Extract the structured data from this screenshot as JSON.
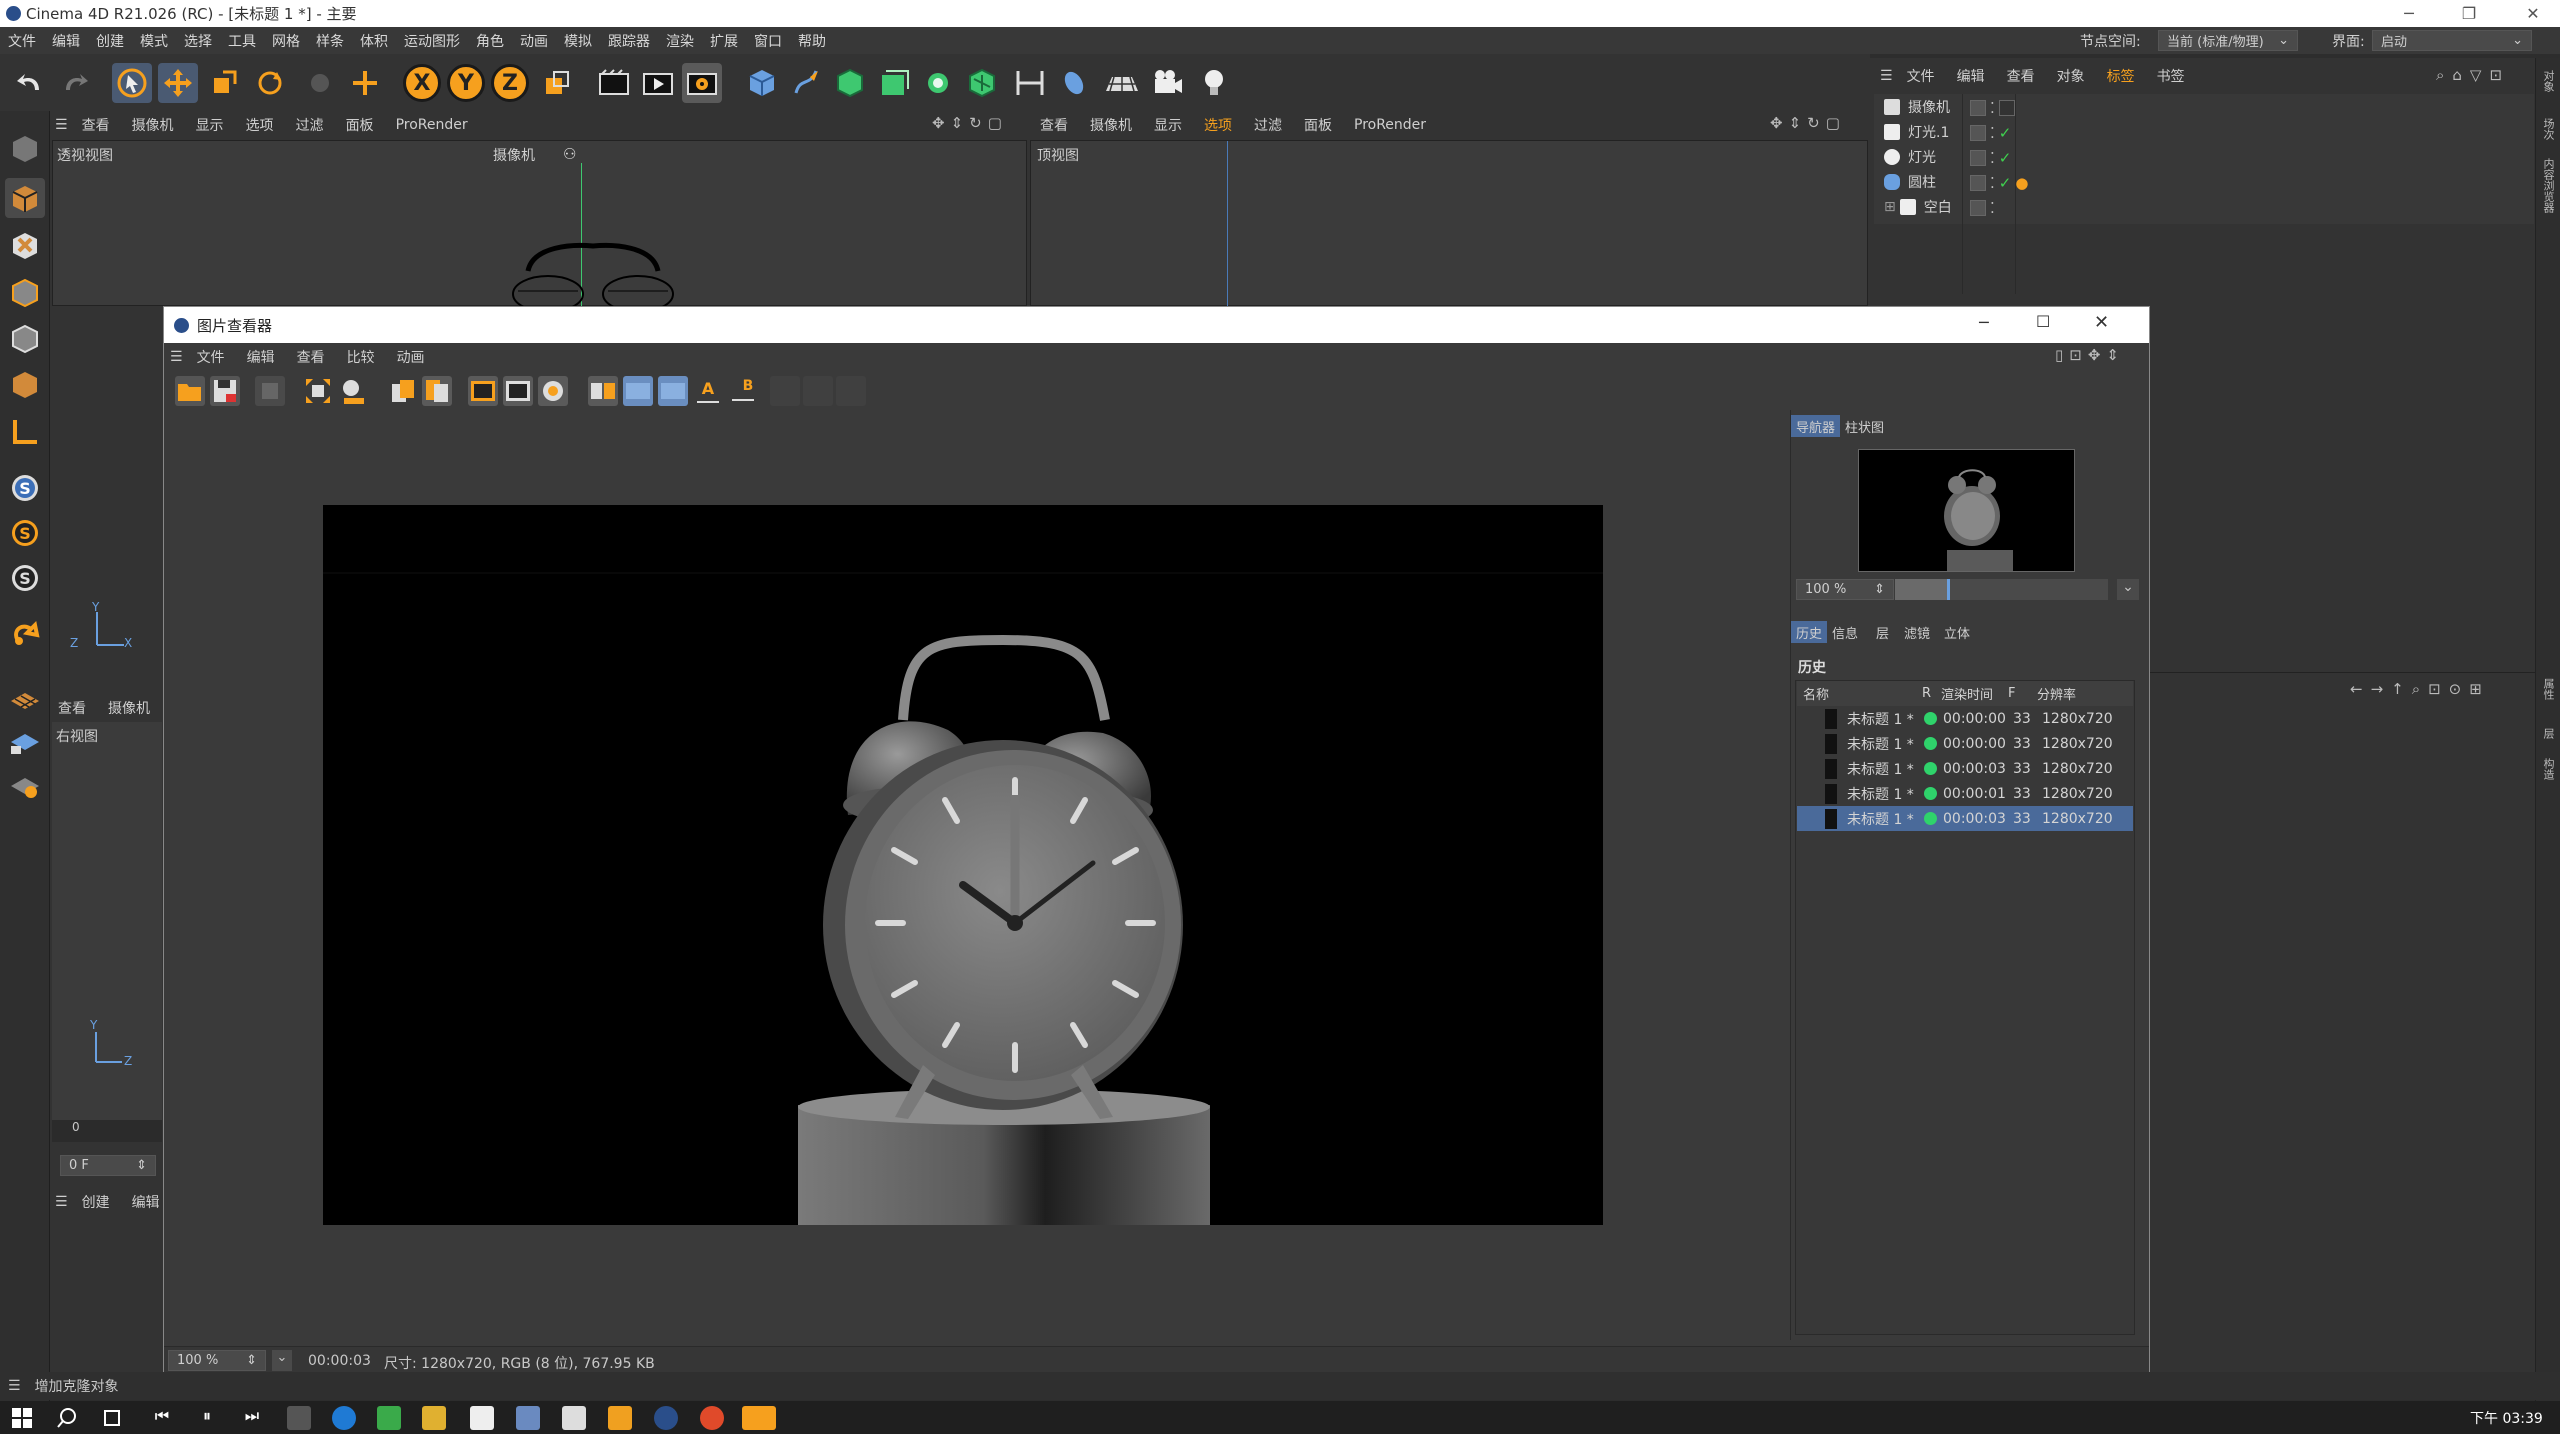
{
  "window": {
    "title": "Cinema 4D R21.026 (RC) - [未标题 1 *] - 主要"
  },
  "menubar": {
    "items": [
      "文件",
      "编辑",
      "创建",
      "模式",
      "选择",
      "工具",
      "网格",
      "样条",
      "体积",
      "运动图形",
      "角色",
      "动画",
      "模拟",
      "跟踪器",
      "渲染",
      "扩展",
      "窗口",
      "帮助"
    ],
    "node_space_label": "节点空间:",
    "node_space_value": "当前 (标准/物理)",
    "interface_label": "界面:",
    "interface_value": "启动"
  },
  "toolbar": {
    "axis_x": "X",
    "axis_y": "Y",
    "axis_z": "Z"
  },
  "viewport_left": {
    "menu": [
      "查看",
      "摄像机",
      "显示",
      "选项",
      "过滤",
      "面板",
      "ProRender"
    ],
    "title": "透视视图",
    "camera_label": "摄像机"
  },
  "viewport_top": {
    "menu": [
      "查看",
      "摄像机",
      "显示",
      "选项",
      "过滤",
      "面板",
      "ProRender"
    ],
    "title": "顶视图"
  },
  "viewport_right": {
    "menu": [
      "查看",
      "摄像机"
    ],
    "title": "右视图"
  },
  "axes_left": {
    "y": "Y",
    "x": "X",
    "z": "Z"
  },
  "axes_right": {
    "y": "Y",
    "z": "Z"
  },
  "timeline": {
    "tick_value": "0",
    "frame_value": "0 F"
  },
  "material_menu": [
    "创建",
    "编辑"
  ],
  "object_manager": {
    "menu": [
      "文件",
      "编辑",
      "查看",
      "对象",
      "标签",
      "书签"
    ],
    "objects": [
      {
        "name": "摄像机"
      },
      {
        "name": "灯光.1"
      },
      {
        "name": "灯光"
      },
      {
        "name": "圆柱"
      },
      {
        "name": "空白"
      }
    ]
  },
  "picture_viewer": {
    "title": "图片查看器",
    "menu": [
      "文件",
      "编辑",
      "查看",
      "比较",
      "动画"
    ],
    "nav_tabs": [
      "导航器",
      "柱状图"
    ],
    "zoom_value": "100 %",
    "tabs": [
      "历史",
      "信息",
      "层",
      "滤镜",
      "立体"
    ],
    "history_title": "历史",
    "history_headers": [
      "名称",
      "R",
      "渲染时间",
      "F",
      "分辨率"
    ],
    "history_rows": [
      {
        "name": "未标题 1 *",
        "time": "00:00:00",
        "f": "33",
        "res": "1280x720"
      },
      {
        "name": "未标题 1 *",
        "time": "00:00:00",
        "f": "33",
        "res": "1280x720"
      },
      {
        "name": "未标题 1 *",
        "time": "00:00:03",
        "f": "33",
        "res": "1280x720"
      },
      {
        "name": "未标题 1 *",
        "time": "00:00:01",
        "f": "33",
        "res": "1280x720"
      },
      {
        "name": "未标题 1 *",
        "time": "00:00:03",
        "f": "33",
        "res": "1280x720"
      }
    ],
    "status_zoom": "100 %",
    "status_time": "00:00:03",
    "status_info": "尺寸: 1280x720, RGB (8 位), 767.95 KB"
  },
  "statusbar": {
    "text": "增加克隆对象"
  },
  "taskbar": {
    "clock": "下午 03:39"
  },
  "right_strip": {
    "labels": [
      "对象",
      "场次",
      "内容浏览器",
      "属性",
      "层",
      "构造"
    ]
  },
  "colors": {
    "accent_orange": "#f6a01e",
    "selected_blue": "#4a6a9a",
    "render_done_green": "#2fd36b"
  }
}
